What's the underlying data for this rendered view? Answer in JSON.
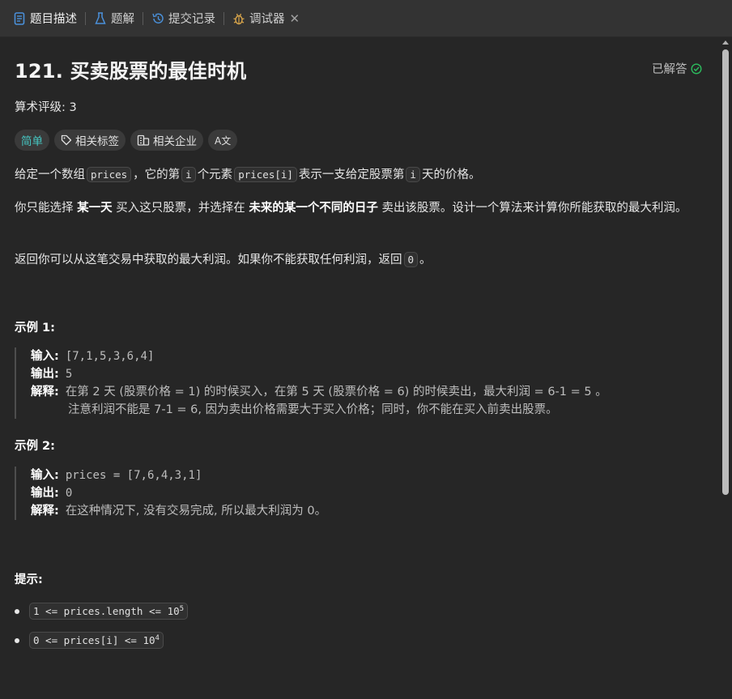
{
  "tabs": [
    {
      "label": "题目描述",
      "icon": "document-icon",
      "color": "#4a90d9"
    },
    {
      "label": "题解",
      "icon": "flask-icon",
      "color": "#4a90d9"
    },
    {
      "label": "提交记录",
      "icon": "history-icon",
      "color": "#4a90d9"
    },
    {
      "label": "调试器",
      "icon": "bug-icon",
      "color": "#d4a24a"
    }
  ],
  "tab_close": "✕",
  "problem": {
    "title": "121. 买卖股票的最佳时机",
    "solved_label": "已解答",
    "rating_label": "算术评级:",
    "rating_value": "3",
    "difficulty": "简单",
    "tags_label": "相关标签",
    "company_label": "相关企业",
    "font_button": "A文"
  },
  "description": {
    "p1_a": "给定一个数组",
    "p1_code1": "prices",
    "p1_b": "，它的第",
    "p1_code2": "i",
    "p1_c": "个元素",
    "p1_code3": "prices[i]",
    "p1_d": "表示一支给定股票第",
    "p1_code4": "i",
    "p1_e": "天的价格。",
    "p2_a": "你只能选择",
    "p2_b1": "某一天",
    "p2_c": "买入这只股票，并选择在",
    "p2_b2": "未来的某一个不同的日子",
    "p2_d": "卖出该股票。设计一个算法来计算你所能获取的最大利润。",
    "p3_a": "返回你可以从这笔交易中获取的最大利润。如果你不能获取任何利润，返回",
    "p3_code": "0",
    "p3_b": "。"
  },
  "examples": [
    {
      "heading": "示例 1:",
      "input_label": "输入:",
      "input": "[7,1,5,3,6,4]",
      "output_label": "输出:",
      "output": "5",
      "explain_label": "解释:",
      "explain_1": "在第 2 天 (股票价格 = 1) 的时候买入，在第 5 天 (股票价格 = 6) 的时候卖出，最大利润 = 6-1 = 5 。",
      "explain_2": "注意利润不能是 7-1 = 6, 因为卖出价格需要大于买入价格；同时，你不能在买入前卖出股票。"
    },
    {
      "heading": "示例 2:",
      "input_label": "输入:",
      "input": "prices = [7,6,4,3,1]",
      "output_label": "输出:",
      "output": "0",
      "explain_label": "解释:",
      "explain_1": "在这种情况下, 没有交易完成, 所以最大利润为 0。"
    }
  ],
  "hints": {
    "title": "提示:",
    "c1_text": "1 <= prices.length <= 10",
    "c1_exp": "5",
    "c2_text": "0 <= prices[i] <= 10",
    "c2_exp": "4"
  },
  "colors": {
    "easy": "#46c6c2",
    "solved_check": "#2cbb5d",
    "background": "#262626",
    "tabbar": "#333333"
  }
}
